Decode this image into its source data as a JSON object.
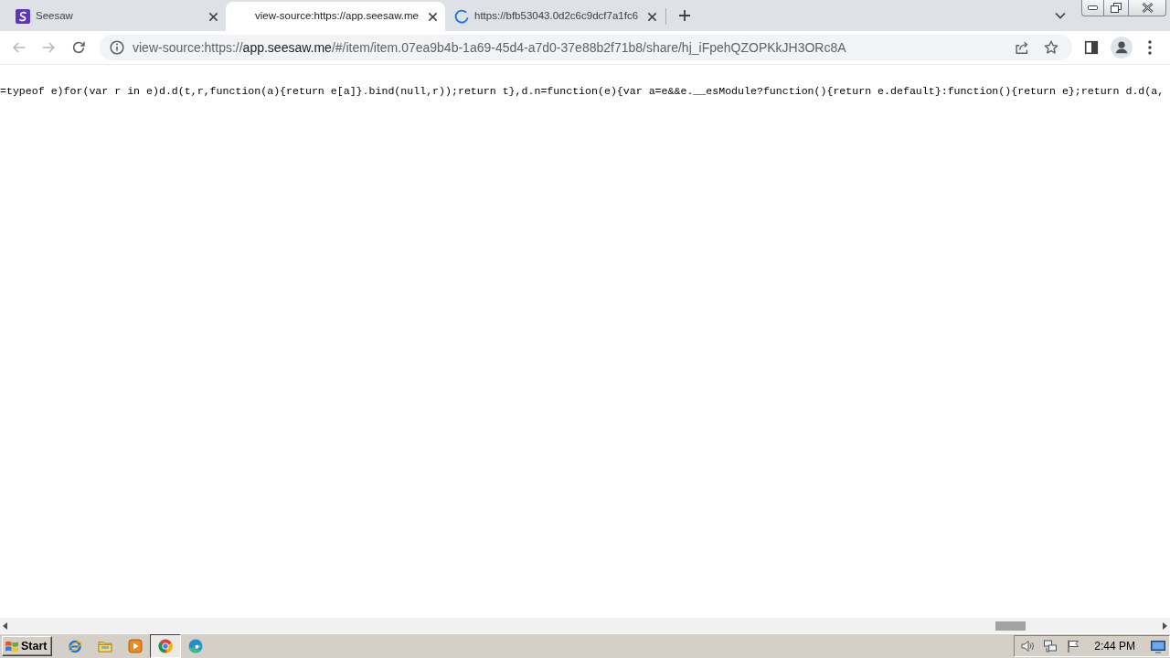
{
  "tabs": [
    {
      "title": "Seesaw",
      "kind": "favicon",
      "selected": false
    },
    {
      "title": "view-source:https://app.seesaw.me",
      "kind": "blank",
      "selected": true
    },
    {
      "title": "https://bfb53043.0d2c6c9dcf7a1fc6",
      "kind": "loading",
      "selected": false
    }
  ],
  "address_bar": {
    "url_parts": [
      {
        "text": "view-source:https://",
        "emphasis": false
      },
      {
        "text": "app.seesaw.me",
        "emphasis": true
      },
      {
        "text": "/#/item/item.07ea9b4b-1a69-45d4-a7d0-37e88b2f71b8/share/hj_iFpehQZOPKkJH3ORc8A",
        "emphasis": false
      }
    ]
  },
  "source_view": {
    "lines": [
      "=typeof e)for(var r in e)d.d(t,r,function(a){return e[a]}.bind(null,r));return t},d.n=function(e){var a=e&&e.__esModule?function(){return e.default}:function(){return e};return d.d(a,"
    ]
  },
  "taskbar": {
    "start_label": "Start",
    "quick_launch": [
      {
        "selected": false
      },
      {
        "selected": false
      },
      {
        "selected": false
      },
      {
        "selected": true
      },
      {
        "selected": false
      }
    ],
    "clock": "2:44 PM"
  }
}
